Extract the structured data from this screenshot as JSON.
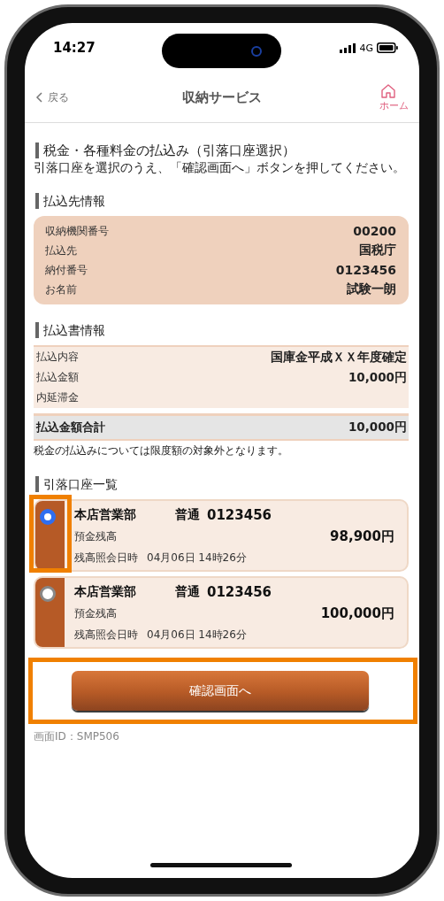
{
  "status_bar": {
    "time": "14:27",
    "network": "4G"
  },
  "nav": {
    "back": "戻る",
    "title": "収納サービス",
    "home": "ホーム"
  },
  "page_title": "税金・各種料金の払込み（引落口座選択）",
  "instruction": "引落口座を選択のうえ、「確認画面へ」ボタンを押してください。",
  "payee": {
    "heading": "払込先情報",
    "rows": [
      {
        "label": "収納機関番号",
        "value": "00200"
      },
      {
        "label": "払込先",
        "value": "国税庁"
      },
      {
        "label": "納付番号",
        "value": "0123456"
      },
      {
        "label": "お名前",
        "value": "試験一朗"
      }
    ]
  },
  "slip": {
    "heading": "払込書情報",
    "rows": [
      {
        "label": "払込内容",
        "value": "国庫金平成ＸＸ年度確定"
      },
      {
        "label": "払込金額",
        "value": "10,000円"
      },
      {
        "label": "内延滞金"
      }
    ],
    "total": {
      "label": "払込金額合計",
      "value": "10,000円"
    },
    "note": "税金の払込みについては限度額の対象外となります。"
  },
  "accounts": {
    "heading": "引落口座一覧",
    "items": [
      {
        "branch": "本店営業部",
        "type": "普通",
        "number": "0123456",
        "balance_label": "預金残高",
        "balance": "98,900円",
        "date_label": "残高照会日時",
        "date": "04月06日 14時26分",
        "selected": true,
        "highlighted": true
      },
      {
        "branch": "本店営業部",
        "type": "普通",
        "number": "0123456",
        "balance_label": "預金残高",
        "balance": "100,000円",
        "date_label": "残高照会日時",
        "date": "04月06日 14時26分",
        "selected": false,
        "highlighted": false
      }
    ]
  },
  "confirm_button": {
    "label": "確認画面へ",
    "highlighted": true
  },
  "screen_id": "画面ID：SMP506"
}
